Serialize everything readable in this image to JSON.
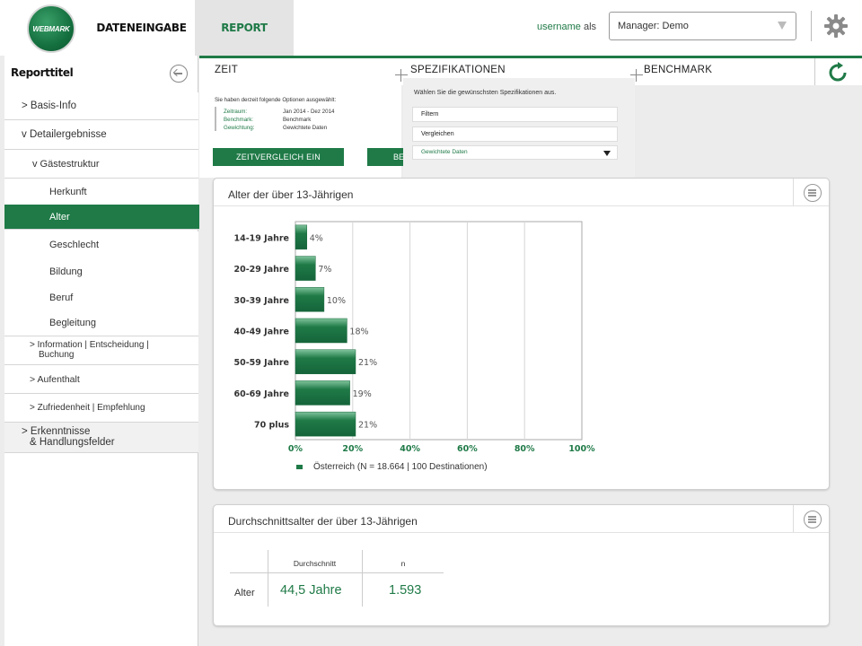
{
  "header": {
    "logo_text": "WEBMARK",
    "nav": [
      "DATENEINGABE",
      "REPORT"
    ],
    "active_nav": "REPORT",
    "username": "username",
    "als": "als",
    "manager_select": "Manager: Demo"
  },
  "sidebar": {
    "title": "Reporttitel",
    "items": [
      {
        "label": "> Basis-Info"
      },
      {
        "label": "v Detailergebnisse"
      },
      {
        "label": "v Gästestruktur"
      },
      {
        "label": "Herkunft"
      },
      {
        "label": "Alter",
        "active": true
      },
      {
        "label": "Geschlecht"
      },
      {
        "label": "Bildung"
      },
      {
        "label": "Beruf"
      },
      {
        "label": "Begleitung"
      },
      {
        "label": "> Information | Entscheidung |",
        "label2": "Buchung"
      },
      {
        "label": "> Aufenthalt"
      },
      {
        "label": "> Zufriedenheit | Empfehlung"
      },
      {
        "label": "> Erkenntnisse",
        "label2": "& Handlungsfelder"
      }
    ]
  },
  "tabs": [
    "ZEIT",
    "SPEZIFIKATIONEN",
    "BENCHMARK"
  ],
  "options": {
    "intro": "Sie haben derzeit folgende Optionen ausgewählt:",
    "rows": [
      {
        "key": "Zeitraum:",
        "value": "Jan 2014 - Dez 2014"
      },
      {
        "key": "Benchmark:",
        "value": "Benchmark"
      },
      {
        "key": "Gewichtung:",
        "value": "Gewichtete Daten"
      }
    ],
    "btn_zeitvergleich": "ZEITVERGLEICH EIN",
    "btn_benchmark_partial": "BE"
  },
  "spec_dropdown": {
    "intro": "Wählen Sie die gewünschsten Spezifikationen aus.",
    "filter": "Filtern",
    "compare": "Vergleichen",
    "weighting": "Gewichtete Daten"
  },
  "age_card": {
    "title": "Alter der über 13-Jährigen",
    "legend": "Österreich (N = 18.664 | 100 Destinationen)"
  },
  "chart_data": {
    "type": "bar",
    "orientation": "horizontal",
    "title": "Alter der über 13-Jährigen",
    "categories": [
      "14-19 Jahre",
      "20-29 Jahre",
      "30-39 Jahre",
      "40-49 Jahre",
      "50-59 Jahre",
      "60-69 Jahre",
      "70 plus"
    ],
    "series": [
      {
        "name": "Österreich (N = 18.664 | 100 Destinationen)",
        "values": [
          4,
          7,
          10,
          18,
          21,
          19,
          21
        ]
      }
    ],
    "value_labels": [
      "4%",
      "7%",
      "10%",
      "18%",
      "21%",
      "19%",
      "21%"
    ],
    "xlim": [
      0,
      100
    ],
    "x_ticks": [
      "0%",
      "20%",
      "40%",
      "60%",
      "80%",
      "100%"
    ],
    "grid": true,
    "legend_position": "bottom-left",
    "bar_color": "#1f7a47"
  },
  "avg_card": {
    "title": "Durchschnittsalter der über 13-Jährigen",
    "headers": [
      "Durchschnitt",
      "n"
    ],
    "row_label": "Alter",
    "average": "44,5 Jahre",
    "n": "1.593"
  },
  "colors": {
    "accent": "#1f7a47",
    "background": "#ececec"
  }
}
